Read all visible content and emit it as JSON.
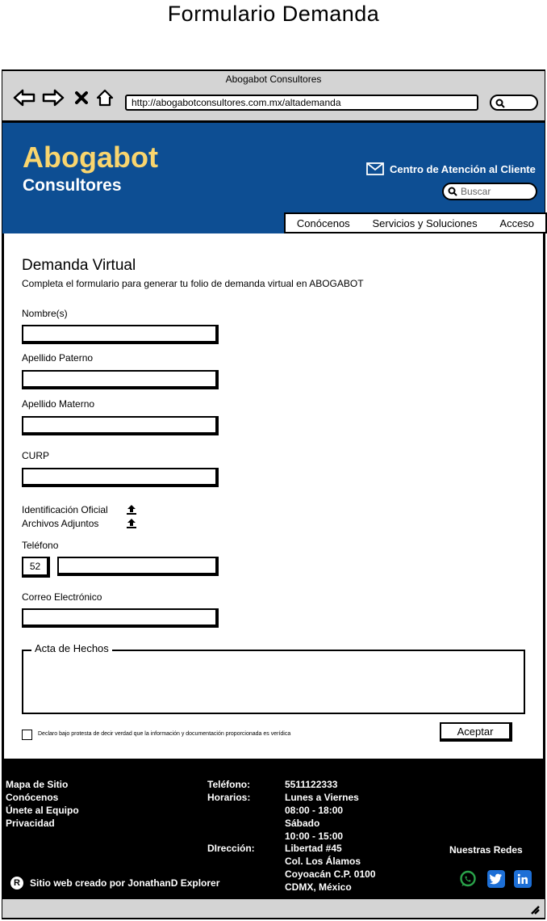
{
  "page": {
    "title": "Formulario Demanda"
  },
  "browser": {
    "window_title": "Abogabot Consultores",
    "url": "http://abogabotconsultores.com.mx/altademanda"
  },
  "header": {
    "brand": "Abogabot",
    "sub_brand": "Consultores",
    "support_label": "Centro de Atención al Cliente",
    "search_placeholder": "Buscar",
    "menu": [
      "Conócenos",
      "Servicios y Soluciones",
      "Acceso"
    ]
  },
  "form": {
    "title": "Demanda Virtual",
    "description": "Completa el formulario para generar tu folio de demanda virtual en ABOGABOT",
    "fields": {
      "nombre": "Nombre(s)",
      "apellido_paterno": "Apellido Paterno",
      "apellido_materno": "Apellido Materno",
      "curp": "CURP",
      "identificacion": "Identificación Oficial",
      "adjuntos": "Archivos Adjuntos",
      "telefono": "Teléfono",
      "telefono_prefix": "52",
      "correo": "Correo Electrónico",
      "acta": "Acta de Hechos"
    },
    "declaration": "Declaro bajo protesta de decir verdad que la información y documentación proporcionada es verídica",
    "submit": "Aceptar"
  },
  "footer": {
    "links": [
      "Mapa de Sitio",
      "Conócenos",
      "Únete al Equipo",
      "Privacidad"
    ],
    "phone_label": "Teléfono:",
    "phone": "5511122333",
    "hours_label": "Horarios:",
    "hours": [
      "Lunes a Viernes",
      "08:00 - 18:00",
      "Sábado",
      "10:00 - 15:00"
    ],
    "address_label": "DIrección:",
    "address": [
      "Libertad #45",
      "Col. Los Álamos",
      "Coyoacán C.P. 0100",
      "CDMX, México"
    ],
    "social_label": "Nuestras Redes",
    "credit_symbol": "R",
    "credit": "Sitio web creado por JonathanD Explorer"
  },
  "colors": {
    "header_bg": "#0d4e93",
    "brand": "#f9d56e",
    "social": "#1d6fd6",
    "whatsapp": "#2aa34a"
  }
}
